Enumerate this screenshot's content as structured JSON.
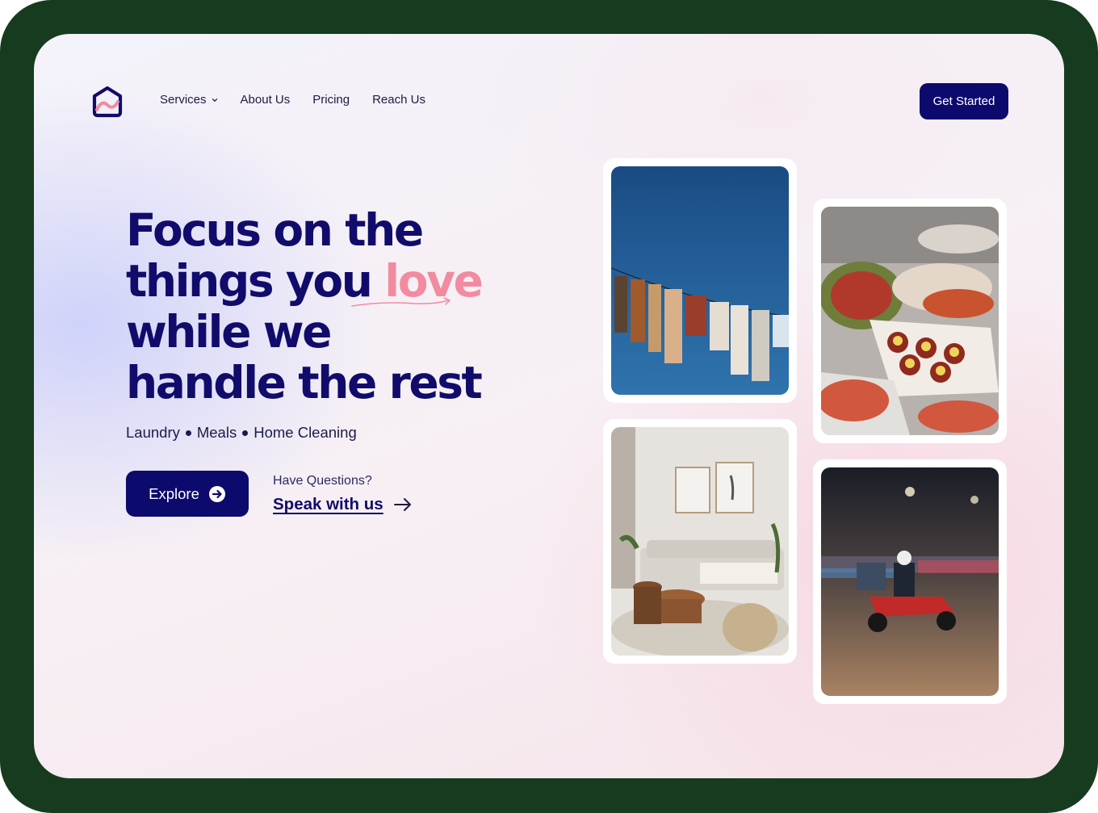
{
  "nav": {
    "items": [
      {
        "label": "Services",
        "has_dropdown": true
      },
      {
        "label": "About Us"
      },
      {
        "label": "Pricing"
      },
      {
        "label": "Reach Us"
      }
    ],
    "cta_label": "Get Started"
  },
  "hero": {
    "headline_lines": [
      "Focus on the",
      "things you ",
      "while we",
      "handle the rest"
    ],
    "highlight_word": "love",
    "services": [
      "Laundry",
      "Meals",
      "Home Cleaning"
    ],
    "explore_label": "Explore",
    "questions_label": "Have Questions?",
    "speak_label": "Speak with us"
  },
  "images": [
    {
      "subject": "clothesline laundry photo",
      "icon": "laundry-image"
    },
    {
      "subject": "meals catering photo",
      "icon": "meals-image"
    },
    {
      "subject": "living room photo",
      "icon": "cleaning-image"
    },
    {
      "subject": "delivery scooter photo",
      "icon": "delivery-image"
    }
  ],
  "colors": {
    "frame": "#173b1f",
    "primary": "#0d0a6e",
    "accent": "#f28ba0",
    "text": "#1d1b4a"
  }
}
